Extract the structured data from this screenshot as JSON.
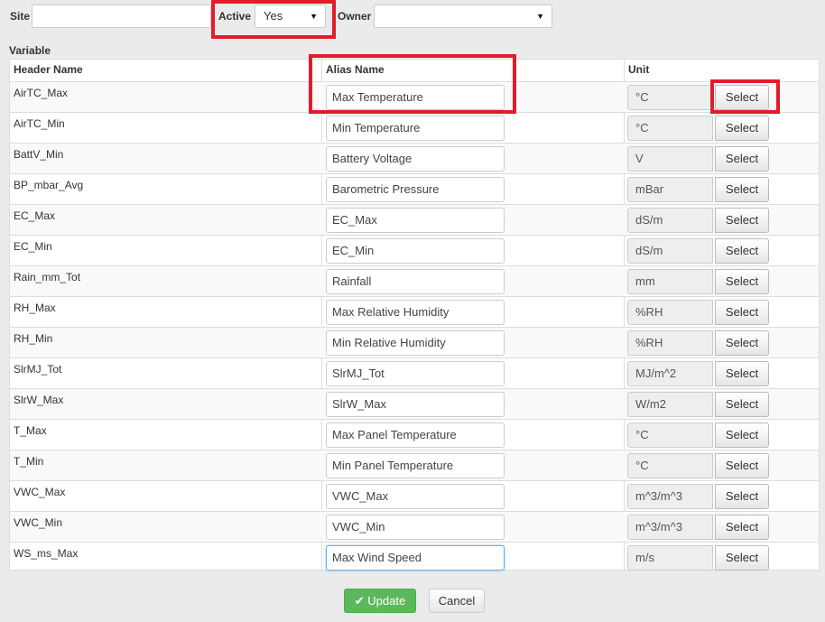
{
  "filters": {
    "site_label": "Site",
    "site_value": "",
    "active_label": "Active",
    "active_value": "Yes",
    "owner_label": "Owner",
    "owner_value": ""
  },
  "table": {
    "section_label": "Variable",
    "headers": {
      "header_name": "Header Name",
      "alias_name": "Alias Name",
      "unit": "Unit"
    },
    "select_label": "Select",
    "rows": [
      {
        "header": "AirTC_Max",
        "alias": "Max Temperature",
        "unit": "°C"
      },
      {
        "header": "AirTC_Min",
        "alias": "Min Temperature",
        "unit": "°C"
      },
      {
        "header": "BattV_Min",
        "alias": "Battery Voltage",
        "unit": "V"
      },
      {
        "header": "BP_mbar_Avg",
        "alias": "Barometric Pressure",
        "unit": "mBar"
      },
      {
        "header": "EC_Max",
        "alias": "EC_Max",
        "unit": "dS/m"
      },
      {
        "header": "EC_Min",
        "alias": "EC_Min",
        "unit": "dS/m"
      },
      {
        "header": "Rain_mm_Tot",
        "alias": "Rainfall",
        "unit": "mm"
      },
      {
        "header": "RH_Max",
        "alias": "Max Relative Humidity",
        "unit": "%RH"
      },
      {
        "header": "RH_Min",
        "alias": "Min Relative Humidity",
        "unit": "%RH"
      },
      {
        "header": "SlrMJ_Tot",
        "alias": "SlrMJ_Tot",
        "unit": "MJ/m^2"
      },
      {
        "header": "SlrW_Max",
        "alias": "SlrW_Max",
        "unit": "W/m2"
      },
      {
        "header": "T_Max",
        "alias": "Max Panel Temperature",
        "unit": "°C"
      },
      {
        "header": "T_Min",
        "alias": "Min Panel Temperature",
        "unit": "°C"
      },
      {
        "header": "VWC_Max",
        "alias": "VWC_Max",
        "unit": "m^3/m^3"
      },
      {
        "header": "VWC_Min",
        "alias": "VWC_Min",
        "unit": "m^3/m^3"
      },
      {
        "header": "WS_ms_Max",
        "alias": "Max Wind Speed",
        "unit": "m/s"
      }
    ]
  },
  "actions": {
    "update_label": "Update",
    "cancel_label": "Cancel"
  },
  "icons": {
    "update": "check-icon",
    "dropdown": "chevron-down-icon"
  },
  "colors": {
    "highlight": "#e11d2b",
    "update_button": "#5cb85c"
  }
}
